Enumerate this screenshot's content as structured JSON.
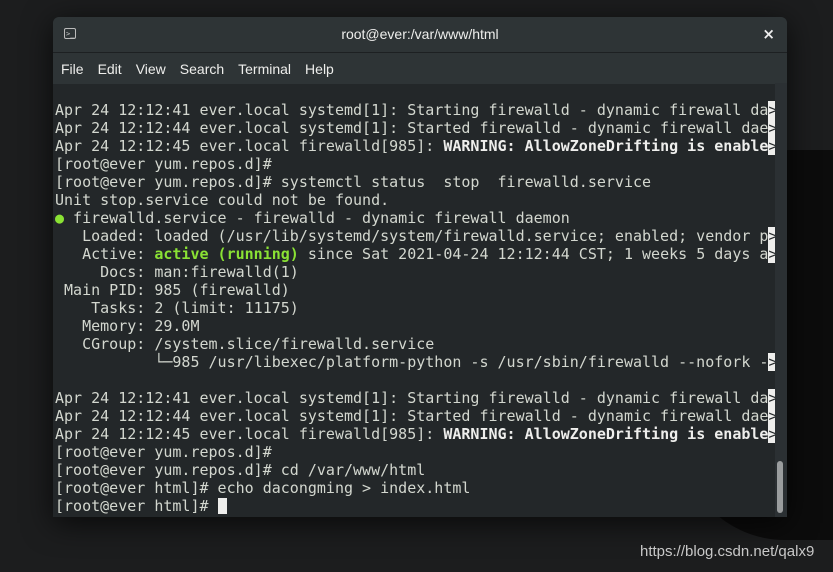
{
  "window": {
    "title": "root@ever:/var/www/html",
    "close_label": "×"
  },
  "menu": [
    "File",
    "Edit",
    "View",
    "Search",
    "Terminal",
    "Help"
  ],
  "terminal_lines": [
    [
      {
        "t": "Apr 24 12:12:41 ever.local systemd[1]: Starting firewalld - dynamic firewall da"
      },
      {
        "t": ">",
        "s": "hl"
      }
    ],
    [
      {
        "t": "Apr 24 12:12:44 ever.local systemd[1]: Started firewalld - dynamic firewall dae"
      },
      {
        "t": ">",
        "s": "hl"
      }
    ],
    [
      {
        "t": "Apr 24 12:12:45 ever.local firewalld[985]: "
      },
      {
        "t": "WARNING: AllowZoneDrifting is enable",
        "s": "b"
      },
      {
        "t": ">",
        "s": "hl"
      }
    ],
    [
      {
        "t": "[root@ever yum.repos.d]#"
      }
    ],
    [
      {
        "t": "[root@ever yum.repos.d]# systemctl status  stop  firewalld.service"
      }
    ],
    [
      {
        "t": "Unit stop.service could not be found."
      }
    ],
    [
      {
        "t": "●",
        "s": "dot"
      },
      {
        "t": " firewalld.service - firewalld - dynamic firewall daemon"
      }
    ],
    [
      {
        "t": "   Loaded: loaded (/usr/lib/systemd/system/firewalld.service; enabled; vendor p"
      },
      {
        "t": ">",
        "s": "hl"
      }
    ],
    [
      {
        "t": "   Active: "
      },
      {
        "t": "active (running)",
        "s": "g"
      },
      {
        "t": " since Sat 2021-04-24 12:12:44 CST; 1 weeks 5 days a"
      },
      {
        "t": ">",
        "s": "hl"
      }
    ],
    [
      {
        "t": "     Docs: man:firewalld(1)"
      }
    ],
    [
      {
        "t": " Main PID: 985 (firewalld)"
      }
    ],
    [
      {
        "t": "    Tasks: 2 (limit: 11175)"
      }
    ],
    [
      {
        "t": "   Memory: 29.0M"
      }
    ],
    [
      {
        "t": "   CGroup: /system.slice/firewalld.service"
      }
    ],
    [
      {
        "t": "           └─985 /usr/libexec/platform-python -s /usr/sbin/firewalld --nofork -"
      },
      {
        "t": ">",
        "s": "hl"
      }
    ],
    [
      {
        "t": ""
      }
    ],
    [
      {
        "t": "Apr 24 12:12:41 ever.local systemd[1]: Starting firewalld - dynamic firewall da"
      },
      {
        "t": ">",
        "s": "hl"
      }
    ],
    [
      {
        "t": "Apr 24 12:12:44 ever.local systemd[1]: Started firewalld - dynamic firewall dae"
      },
      {
        "t": ">",
        "s": "hl"
      }
    ],
    [
      {
        "t": "Apr 24 12:12:45 ever.local firewalld[985]: "
      },
      {
        "t": "WARNING: AllowZoneDrifting is enable",
        "s": "b"
      },
      {
        "t": ">",
        "s": "hl"
      }
    ],
    [
      {
        "t": "[root@ever yum.repos.d]#"
      }
    ],
    [
      {
        "t": "[root@ever yum.repos.d]# cd /var/www/html"
      }
    ],
    [
      {
        "t": "[root@ever html]# echo dacongming > index.html"
      }
    ],
    [
      {
        "t": "[root@ever html]# "
      }
    ]
  ],
  "watermark": "https://blog.csdn.net/qalx9",
  "colors": {
    "terminal_bg": "#232729",
    "text": "#d3d7cf",
    "active_green": "#8ae234"
  }
}
